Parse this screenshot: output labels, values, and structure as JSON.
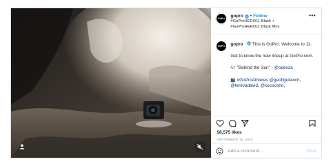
{
  "post": {
    "account": {
      "username": "gopro",
      "avatar_text": "GoPro",
      "verified": true,
      "follow_separator": "•",
      "follow_label": "Follow",
      "subline_1": "#GoProHERO11 Black +",
      "subline_2": "#GoProHERO11 Black Mini",
      "more_label": "•••"
    },
    "caption": {
      "username": "gopro",
      "line_intro": "This is GoPro. Welcome to 11.",
      "line_lineup": "Get to know the new lineup at GoPro.com.",
      "music_emoji": "🎶",
      "music_text": "\"Behind the Sun\" - ",
      "music_mention": "@odesza",
      "clapper_emoji": "🎬",
      "athletes_prefix": "#GoProAthletes ",
      "athletes_mention_1": "@geoffgulevich",
      "athletes_mention_2": "@terevadavid",
      "athletes_mention_3": "@xococoho",
      "athletes_sep_1": ", ",
      "athletes_sep_2": ", ",
      "athletes_sep_3": ","
    },
    "likes_label": "58,575 likes",
    "date_label": "SEPTEMBER 15, 2022",
    "comment": {
      "placeholder": "Add a comment...",
      "post_label": "Post"
    },
    "icons": {
      "like": "heart-icon",
      "comment": "comment-icon",
      "share": "share-icon",
      "save": "bookmark-icon",
      "emoji": "smile-icon",
      "user_tag": "user-icon",
      "mute": "mute-icon",
      "verified": "verified-badge-icon"
    },
    "colors": {
      "follow": "#0095f6",
      "verified": "#3897f0",
      "mention": "#00376b",
      "post_disabled": "#b2dffc"
    }
  }
}
